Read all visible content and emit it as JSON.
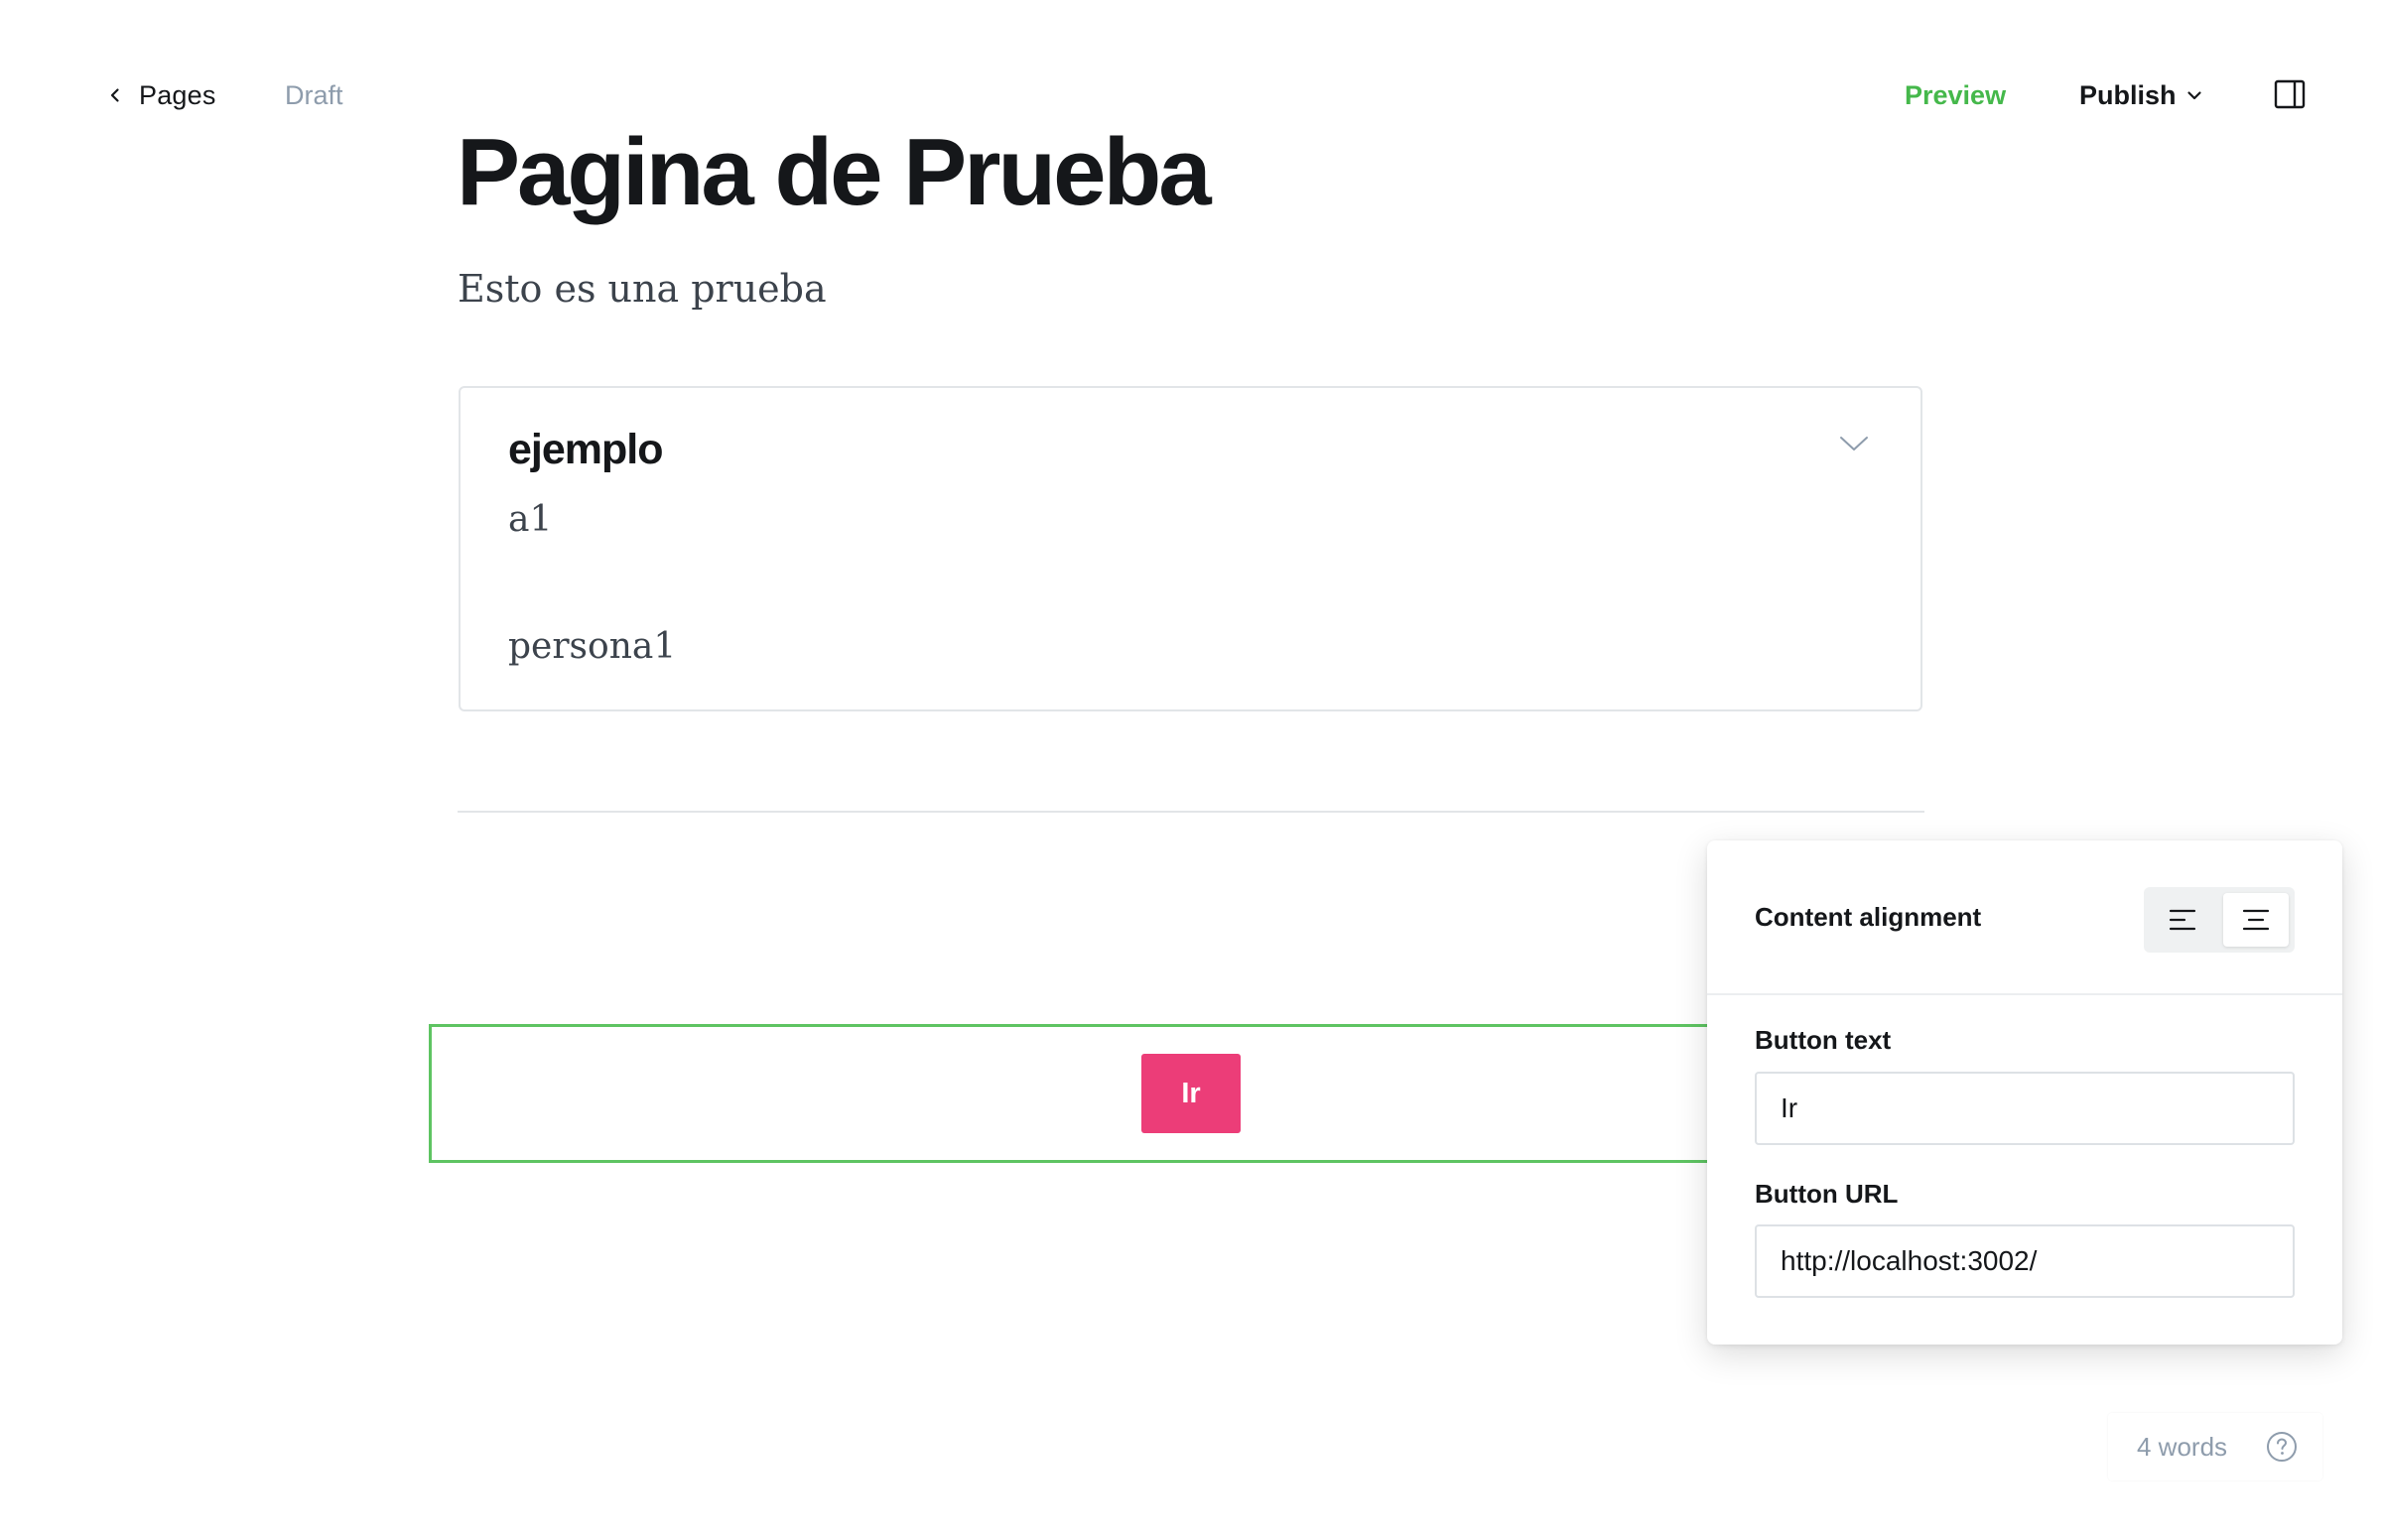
{
  "topbar": {
    "back_label": "Pages",
    "status": "Draft",
    "preview_label": "Preview",
    "publish_label": "Publish"
  },
  "post": {
    "title": "Pagina de Prueba",
    "excerpt": "Esto es una prueba"
  },
  "toggle_card": {
    "heading": "ejemplo",
    "lines": [
      "a1",
      "persona1"
    ]
  },
  "button_card": {
    "button_text": "Ir",
    "button_color": "#ec3d78",
    "selected_border_color": "#5ec462"
  },
  "settings_panel": {
    "alignment_label": "Content alignment",
    "alignment_options": [
      "left",
      "center"
    ],
    "alignment_selected": "center",
    "button_text_label": "Button text",
    "button_text_value": "Ir",
    "button_url_label": "Button URL",
    "button_url_value": "http://localhost:3002/"
  },
  "footer": {
    "word_count": "4 words"
  },
  "colors": {
    "accent_green": "#45b84b",
    "muted": "#8e9cac"
  },
  "icons": [
    "chevron-left-icon",
    "chevron-down-icon",
    "sidebar-panel-icon",
    "align-left-icon",
    "align-center-icon",
    "help-circle-icon"
  ]
}
